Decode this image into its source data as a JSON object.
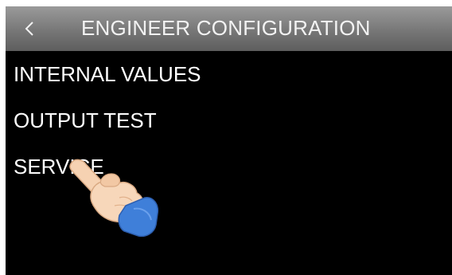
{
  "header": {
    "back_icon": "chevron-left-icon",
    "title": "ENGINEER CONFIGURATION"
  },
  "menu": {
    "items": [
      {
        "label": "INTERNAL VALUES"
      },
      {
        "label": "OUTPUT TEST"
      },
      {
        "label": "SERVICE"
      }
    ]
  },
  "overlay": {
    "icon": "pointing-hand-icon"
  },
  "colors": {
    "background": "#000000",
    "header_gradient_top": "#9a9a9a",
    "header_gradient_bottom": "#5e5e5e",
    "text": "#ffffff",
    "cuff": "#3f7fd9",
    "skin": "#f6d2b2"
  }
}
